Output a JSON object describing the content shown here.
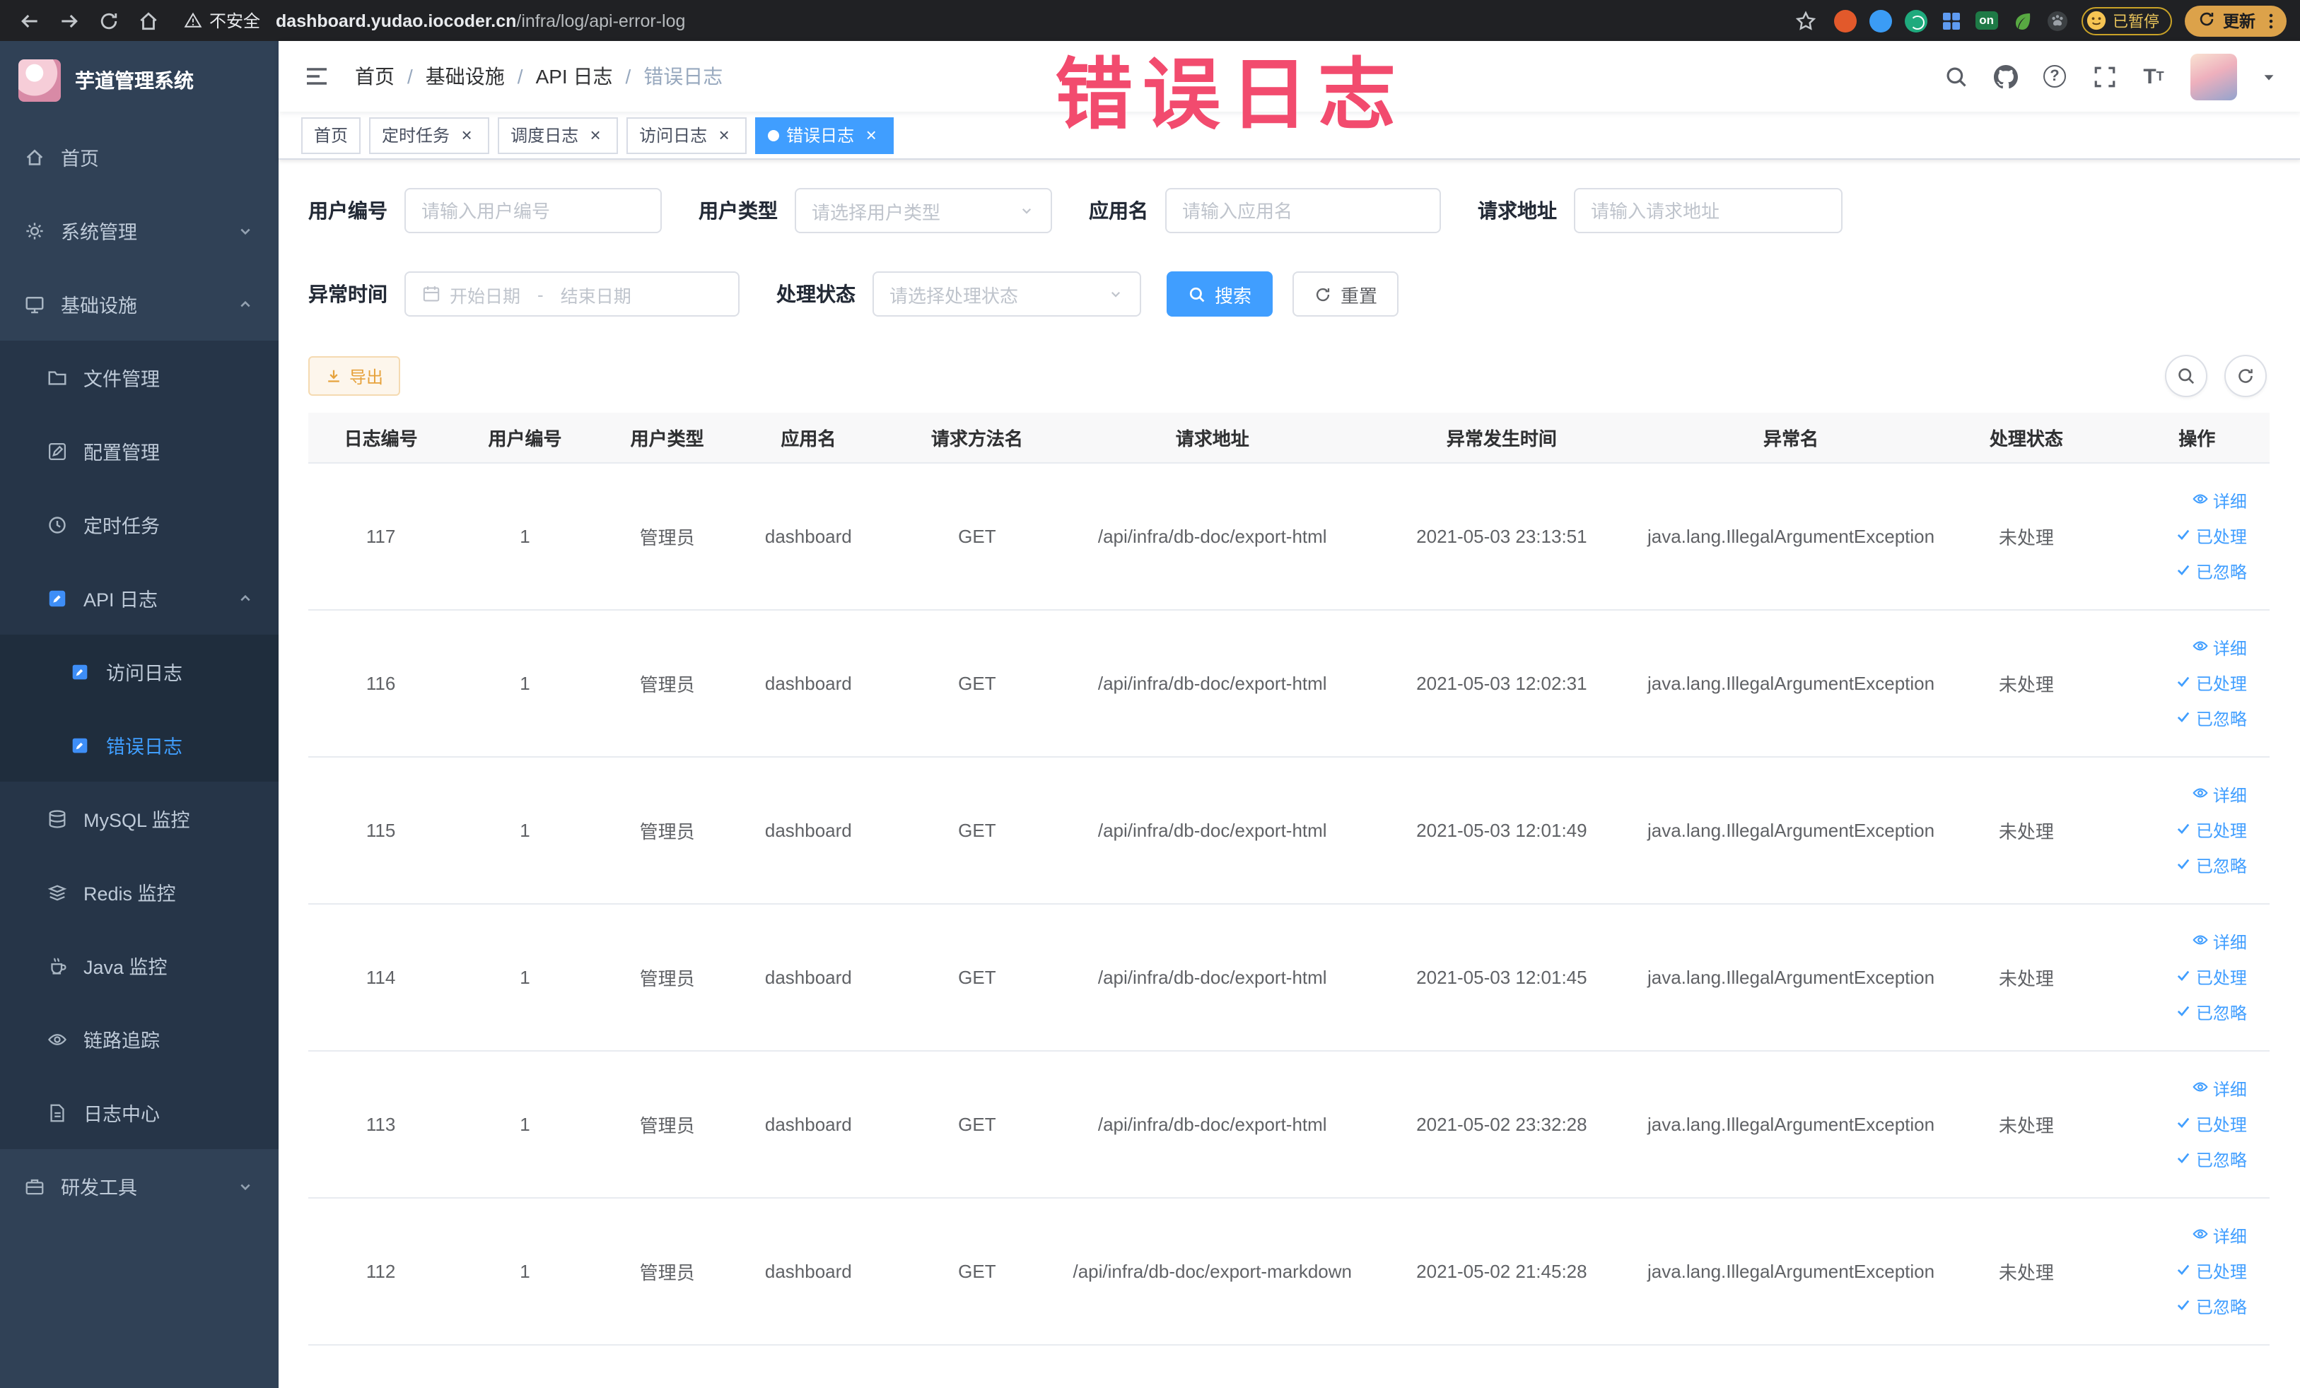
{
  "colors": {
    "primary": "#409EFF",
    "warning": "#E6A23C",
    "watermark_pink": "#F24B6E",
    "sidebar_bg": "#304156",
    "chrome_bg": "#202124",
    "submenu_bg": "#1F2D3D"
  },
  "watermark_text": "错误日志",
  "browser": {
    "security_label": "不安全",
    "url_domain": "dashboard.yudao.iocoder.cn",
    "url_path": "/infra/log/api-error-log",
    "on_badge": "on",
    "paused_badge": "已暂停",
    "update_label": "更新"
  },
  "sidebar": {
    "logo_title": "芋道管理系统",
    "items": [
      {
        "label": "首页",
        "icon": "home-icon",
        "depth": 0
      },
      {
        "label": "系统管理",
        "icon": "gear-icon",
        "depth": 0,
        "chevron": "down"
      },
      {
        "label": "基础设施",
        "icon": "monitor-icon",
        "depth": 0,
        "chevron": "up"
      },
      {
        "label": "文件管理",
        "icon": "folder-icon",
        "depth": 1
      },
      {
        "label": "配置管理",
        "icon": "config-icon",
        "depth": 1
      },
      {
        "label": "定时任务",
        "icon": "clock-icon",
        "depth": 1
      },
      {
        "label": "API 日志",
        "icon": "api-log-icon",
        "depth": 1,
        "chevron": "up"
      },
      {
        "label": "访问日志",
        "icon": "doc-edit-icon",
        "depth": 2
      },
      {
        "label": "错误日志",
        "icon": "doc-edit-icon",
        "depth": 2,
        "active": true
      },
      {
        "label": "MySQL 监控",
        "icon": "database-icon",
        "depth": 1
      },
      {
        "label": "Redis 监控",
        "icon": "redis-icon",
        "depth": 1
      },
      {
        "label": "Java 监控",
        "icon": "java-icon",
        "depth": 1
      },
      {
        "label": "链路追踪",
        "icon": "trace-icon",
        "depth": 1
      },
      {
        "label": "日志中心",
        "icon": "doc-icon",
        "depth": 1
      },
      {
        "label": "研发工具",
        "icon": "toolbox-icon",
        "depth": 0,
        "chevron": "down"
      }
    ]
  },
  "breadcrumb": [
    "首页",
    "基础设施",
    "API 日志",
    "错误日志"
  ],
  "tabs": [
    {
      "label": "首页",
      "closable": false,
      "active": false
    },
    {
      "label": "定时任务",
      "closable": true,
      "active": false
    },
    {
      "label": "调度日志",
      "closable": true,
      "active": false
    },
    {
      "label": "访问日志",
      "closable": true,
      "active": false
    },
    {
      "label": "错误日志",
      "closable": true,
      "active": true
    }
  ],
  "filters": {
    "user_id_label": "用户编号",
    "user_id_placeholder": "请输入用户编号",
    "user_type_label": "用户类型",
    "user_type_placeholder": "请选择用户类型",
    "app_name_label": "应用名",
    "app_name_placeholder": "请输入应用名",
    "request_url_label": "请求地址",
    "request_url_placeholder": "请输入请求地址",
    "time_label": "异常时间",
    "time_start_placeholder": "开始日期",
    "time_separator": "-",
    "time_end_placeholder": "结束日期",
    "status_label": "处理状态",
    "status_placeholder": "请选择处理状态",
    "search_label": "搜索",
    "reset_label": "重置"
  },
  "toolbar": {
    "export_label": "导出"
  },
  "table": {
    "columns": [
      "日志编号",
      "用户编号",
      "用户类型",
      "应用名",
      "请求方法名",
      "请求地址",
      "异常发生时间",
      "异常名",
      "处理状态",
      "操作"
    ],
    "rows": [
      [
        "117",
        "1",
        "管理员",
        "dashboard",
        "GET",
        "/api/infra/db-doc/export-html",
        "2021-05-03 23:13:51",
        "java.lang.IllegalArgumentException",
        "未处理"
      ],
      [
        "116",
        "1",
        "管理员",
        "dashboard",
        "GET",
        "/api/infra/db-doc/export-html",
        "2021-05-03 12:02:31",
        "java.lang.IllegalArgumentException",
        "未处理"
      ],
      [
        "115",
        "1",
        "管理员",
        "dashboard",
        "GET",
        "/api/infra/db-doc/export-html",
        "2021-05-03 12:01:49",
        "java.lang.IllegalArgumentException",
        "未处理"
      ],
      [
        "114",
        "1",
        "管理员",
        "dashboard",
        "GET",
        "/api/infra/db-doc/export-html",
        "2021-05-03 12:01:45",
        "java.lang.IllegalArgumentException",
        "未处理"
      ],
      [
        "113",
        "1",
        "管理员",
        "dashboard",
        "GET",
        "/api/infra/db-doc/export-html",
        "2021-05-02 23:32:28",
        "java.lang.IllegalArgumentException",
        "未处理"
      ],
      [
        "112",
        "1",
        "管理员",
        "dashboard",
        "GET",
        "/api/infra/db-doc/export-markdown",
        "2021-05-02 21:45:28",
        "java.lang.IllegalArgumentException",
        "未处理"
      ]
    ],
    "row_actions": [
      "详细",
      "已处理",
      "已忽略"
    ]
  }
}
